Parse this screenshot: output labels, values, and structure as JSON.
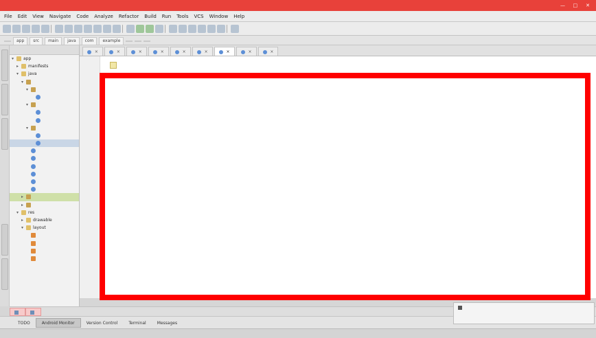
{
  "titlebar": {
    "text": "",
    "close": "✕",
    "max": "□",
    "min": "—"
  },
  "menubar": {
    "items": [
      "File",
      "Edit",
      "View",
      "Navigate",
      "Code",
      "Analyze",
      "Refactor",
      "Build",
      "Run",
      "Tools",
      "VCS",
      "Window",
      "Help"
    ]
  },
  "navbar": {
    "crumbs": [
      "",
      "app",
      "src",
      "main",
      "java",
      "com",
      "example",
      "",
      "",
      ""
    ]
  },
  "project_panel": {
    "header": "",
    "tree": [
      {
        "label": "app",
        "indent": 0,
        "icon": "folder",
        "arrow": "▾"
      },
      {
        "label": "manifests",
        "indent": 1,
        "icon": "folder",
        "arrow": "▸"
      },
      {
        "label": "java",
        "indent": 1,
        "icon": "folder",
        "arrow": "▾"
      },
      {
        "label": "",
        "indent": 2,
        "icon": "pkg",
        "arrow": "▾"
      },
      {
        "label": "",
        "indent": 3,
        "icon": "pkg",
        "arrow": "▾"
      },
      {
        "label": "",
        "indent": 4,
        "icon": "cls",
        "arrow": ""
      },
      {
        "label": "",
        "indent": 3,
        "icon": "pkg",
        "arrow": "▾"
      },
      {
        "label": "",
        "indent": 4,
        "icon": "cls",
        "arrow": ""
      },
      {
        "label": "",
        "indent": 4,
        "icon": "cls",
        "arrow": ""
      },
      {
        "label": "",
        "indent": 3,
        "icon": "pkg",
        "arrow": "▾"
      },
      {
        "label": "",
        "indent": 4,
        "icon": "cls",
        "arrow": ""
      },
      {
        "label": "",
        "indent": 4,
        "icon": "cls",
        "arrow": "",
        "selected": true
      },
      {
        "label": "",
        "indent": 3,
        "icon": "cls",
        "arrow": ""
      },
      {
        "label": "",
        "indent": 3,
        "icon": "cls",
        "arrow": ""
      },
      {
        "label": "",
        "indent": 3,
        "icon": "cls",
        "arrow": ""
      },
      {
        "label": "",
        "indent": 3,
        "icon": "cls",
        "arrow": ""
      },
      {
        "label": "",
        "indent": 3,
        "icon": "cls",
        "arrow": ""
      },
      {
        "label": "",
        "indent": 3,
        "icon": "cls",
        "arrow": ""
      },
      {
        "label": "",
        "indent": 2,
        "icon": "pkg",
        "arrow": "▸",
        "highlight": true
      },
      {
        "label": "",
        "indent": 2,
        "icon": "pkg",
        "arrow": "▸"
      },
      {
        "label": "res",
        "indent": 1,
        "icon": "folder",
        "arrow": "▾"
      },
      {
        "label": "drawable",
        "indent": 2,
        "icon": "folder",
        "arrow": "▸"
      },
      {
        "label": "layout",
        "indent": 2,
        "icon": "folder",
        "arrow": "▾"
      },
      {
        "label": "",
        "indent": 3,
        "icon": "xml",
        "arrow": ""
      },
      {
        "label": "",
        "indent": 3,
        "icon": "xml",
        "arrow": ""
      },
      {
        "label": "",
        "indent": 3,
        "icon": "xml",
        "arrow": ""
      },
      {
        "label": "",
        "indent": 3,
        "icon": "xml",
        "arrow": ""
      }
    ]
  },
  "editor_tabs": [
    {
      "label": "",
      "active": false
    },
    {
      "label": "",
      "active": false
    },
    {
      "label": "",
      "active": false
    },
    {
      "label": "",
      "active": false
    },
    {
      "label": "",
      "active": false
    },
    {
      "label": "",
      "active": false
    },
    {
      "label": "",
      "active": true
    },
    {
      "label": "",
      "active": false
    },
    {
      "label": "",
      "active": false
    }
  ],
  "code_lines": [
    {
      "text": "",
      "cls": ""
    },
    {
      "text": "",
      "cls": ""
    },
    {
      "text": "",
      "cls": "cm"
    },
    {
      "text": "",
      "cls": ""
    },
    {
      "text": "",
      "cls": "kw"
    },
    {
      "text": "",
      "cls": ""
    },
    {
      "text": "",
      "cls": ""
    },
    {
      "text": "",
      "cls": ""
    },
    {
      "text": "",
      "cls": ""
    },
    {
      "text": "",
      "cls": ""
    },
    {
      "text": "",
      "cls": ""
    },
    {
      "text": "",
      "cls": ""
    },
    {
      "text": "",
      "cls": ""
    },
    {
      "text": "",
      "cls": ""
    },
    {
      "text": "",
      "cls": ""
    },
    {
      "text": "",
      "cls": ""
    },
    {
      "text": "",
      "cls": ""
    },
    {
      "text": "",
      "cls": ""
    },
    {
      "text": "",
      "cls": ""
    },
    {
      "text": "",
      "cls": ""
    },
    {
      "text": "",
      "cls": ""
    },
    {
      "text": "",
      "cls": ""
    },
    {
      "text": "",
      "cls": ""
    },
    {
      "text": "",
      "cls": ""
    },
    {
      "text": "",
      "cls": ""
    },
    {
      "text": "",
      "cls": ""
    },
    {
      "text": "",
      "cls": ""
    },
    {
      "text": "",
      "cls": ""
    },
    {
      "text": "",
      "cls": ""
    },
    {
      "text": "",
      "cls": ""
    },
    {
      "text": "",
      "cls": ""
    }
  ],
  "bottom_tabs": [
    {
      "label": "",
      "red": true
    },
    {
      "label": "",
      "red": true
    }
  ],
  "tool_windows": [
    {
      "label": "TODO",
      "active": false
    },
    {
      "label": "Android Monitor",
      "active": true
    },
    {
      "label": "Version Control",
      "active": false
    },
    {
      "label": "Terminal",
      "active": false
    },
    {
      "label": "Messages",
      "active": false
    }
  ],
  "notification": {
    "line1": "",
    "line2": "",
    "link": ""
  },
  "statusbar": {
    "left": "",
    "right": ""
  },
  "annotation": {
    "color": "#ff0000"
  }
}
